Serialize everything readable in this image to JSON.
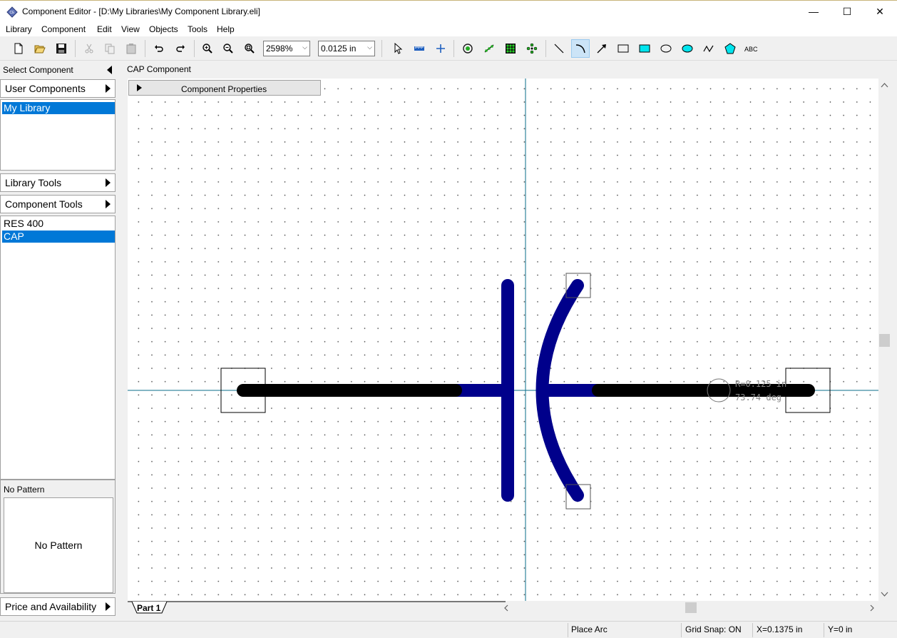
{
  "window": {
    "title": "Component Editor - [D:\\My Libraries\\My Component Library.eli]",
    "controls": {
      "minimize": "—",
      "maximize": "☐",
      "close": "✕"
    }
  },
  "menu": [
    "Library",
    "Component",
    "Edit",
    "View",
    "Objects",
    "Tools",
    "Help"
  ],
  "toolbar": {
    "zoom_value": "2598%",
    "grid_value": "0.0125 in",
    "active_tool": "arc-tool"
  },
  "left_panel": {
    "select_component_label": "Select Component",
    "user_components_label": "User Components",
    "libraries": [
      {
        "label": "My Library",
        "selected": true
      }
    ],
    "library_tools_label": "Library Tools",
    "component_tools_label": "Component Tools",
    "components": [
      {
        "label": "RES 400",
        "selected": false
      },
      {
        "label": "CAP",
        "selected": true
      }
    ],
    "pattern_header": "No Pattern",
    "pattern_preview_text": "No Pattern",
    "price_label": "Price and Availability"
  },
  "canvas": {
    "title": "CAP Component",
    "properties_tab_label": "Component Properties",
    "arc_readout_radius": "R=0.125 in",
    "arc_readout_angle": "73.74 deg",
    "sheet_tab_label": "Part 1",
    "colors": {
      "wire": "#000000",
      "symbol": "#00008b",
      "crosshair": "#0a6e8a"
    }
  },
  "status": {
    "mode": "Place Arc",
    "grid_snap": "Grid Snap: ON",
    "x": "X=0.1375 in",
    "y": "Y=0 in"
  }
}
